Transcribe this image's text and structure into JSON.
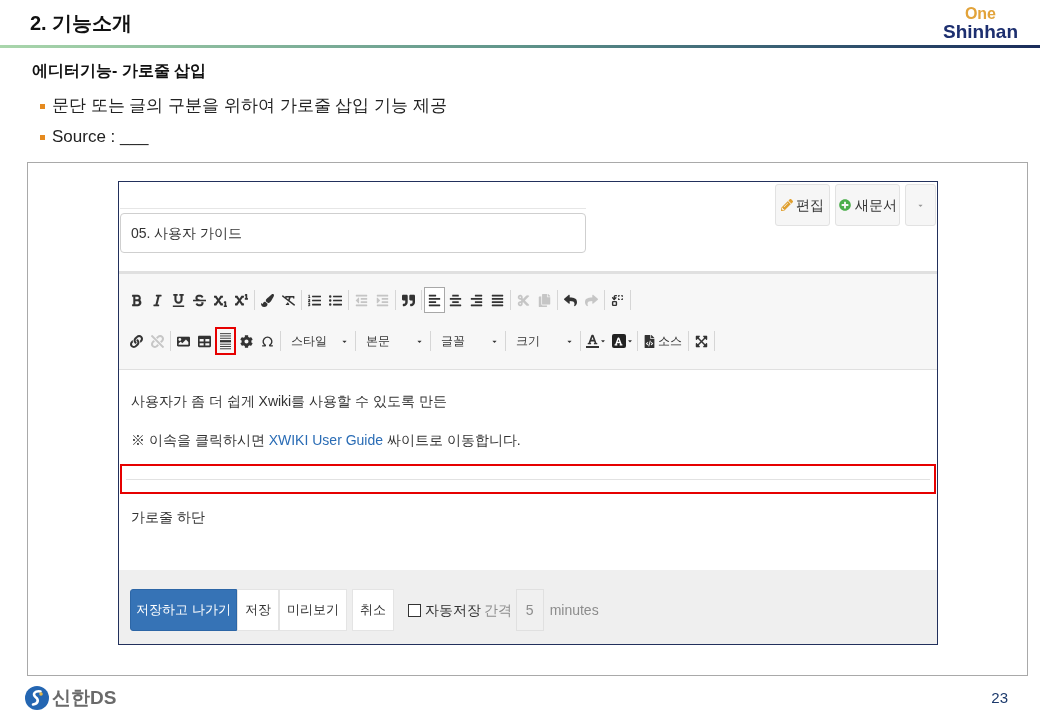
{
  "header": {
    "title": "2. 기능소개",
    "logo": {
      "top": "One",
      "bottom": "Shinhan"
    }
  },
  "heading": "에디터기능- 가로줄 삽입",
  "bullets": [
    "문단 또는 글의 구분을 위하여 가로줄 삽입 기능 제공",
    "Source : ___"
  ],
  "editor": {
    "page_actions": [
      {
        "kind": "edit",
        "label": "편집"
      },
      {
        "kind": "new",
        "label": "새문서"
      },
      {
        "kind": "more"
      }
    ],
    "title_field": {
      "value": "05. 사용자 가이드"
    },
    "toolbar_rows": [
      [
        [
          {
            "kind": "bold",
            "disabled": false,
            "active": false,
            "highlighted": false
          },
          {
            "kind": "italic",
            "disabled": false,
            "active": false,
            "highlighted": false
          },
          {
            "kind": "underline",
            "disabled": false,
            "active": false,
            "highlighted": false
          },
          {
            "kind": "strike",
            "disabled": false,
            "active": false,
            "highlighted": false
          },
          {
            "kind": "subscript",
            "disabled": false,
            "active": false,
            "highlighted": false
          },
          {
            "kind": "superscript",
            "disabled": false,
            "active": false,
            "highlighted": false
          }
        ],
        [
          {
            "kind": "paint",
            "disabled": false,
            "active": false,
            "highlighted": false
          },
          {
            "kind": "clearformat",
            "disabled": false,
            "active": false,
            "highlighted": false
          }
        ],
        [
          {
            "kind": "numbered",
            "disabled": false,
            "active": false,
            "highlighted": false
          },
          {
            "kind": "bulleted",
            "disabled": false,
            "active": false,
            "highlighted": false
          }
        ],
        [
          {
            "kind": "outdent",
            "disabled": true,
            "active": false,
            "highlighted": false
          },
          {
            "kind": "indent",
            "disabled": true,
            "active": false,
            "highlighted": false
          }
        ],
        [
          {
            "kind": "quote",
            "disabled": false,
            "active": false,
            "highlighted": false
          }
        ],
        [
          {
            "kind": "left",
            "disabled": false,
            "active": true,
            "highlighted": false
          },
          {
            "kind": "center",
            "disabled": false,
            "active": false,
            "highlighted": false
          },
          {
            "kind": "right",
            "disabled": false,
            "active": false,
            "highlighted": false
          },
          {
            "kind": "justify",
            "disabled": false,
            "active": false,
            "highlighted": false
          }
        ],
        [
          {
            "kind": "cut",
            "disabled": true,
            "active": false,
            "highlighted": false
          },
          {
            "kind": "copy",
            "disabled": true,
            "active": false,
            "highlighted": false
          }
        ],
        [
          {
            "kind": "undo",
            "disabled": false,
            "active": false,
            "highlighted": false
          },
          {
            "kind": "redo",
            "disabled": true,
            "active": false,
            "highlighted": false
          }
        ],
        [
          {
            "kind": "replace",
            "disabled": false,
            "active": false,
            "highlighted": false
          }
        ]
      ],
      [
        [
          {
            "kind": "link",
            "disabled": false,
            "active": false,
            "highlighted": false
          },
          {
            "kind": "unlink",
            "disabled": true,
            "active": false,
            "highlighted": false
          }
        ],
        [
          {
            "kind": "image",
            "disabled": false,
            "active": false,
            "highlighted": false
          },
          {
            "kind": "table",
            "disabled": false,
            "active": false,
            "highlighted": false
          },
          {
            "kind": "hr",
            "disabled": false,
            "active": false,
            "highlighted": true
          },
          {
            "kind": "gear",
            "disabled": false,
            "active": false,
            "highlighted": false
          },
          {
            "kind": "symbol",
            "disabled": false,
            "active": false,
            "highlighted": false
          }
        ],
        [
          {
            "kind": "combo",
            "label": "스타일",
            "disabled": false,
            "active": false,
            "highlighted": false
          }
        ],
        [
          {
            "kind": "combo",
            "label": "본문",
            "disabled": false,
            "active": false,
            "highlighted": false
          }
        ],
        [
          {
            "kind": "combo",
            "label": "글꼴",
            "disabled": false,
            "active": false,
            "highlighted": false
          }
        ],
        [
          {
            "kind": "combo",
            "label": "크기",
            "disabled": false,
            "active": false,
            "highlighted": false
          }
        ],
        [
          {
            "kind": "textcolor",
            "disabled": false,
            "active": false,
            "highlighted": false
          },
          {
            "kind": "bgcolor",
            "disabled": false,
            "active": false,
            "highlighted": false
          }
        ],
        [
          {
            "kind": "source",
            "label": "소스",
            "disabled": false,
            "active": false,
            "highlighted": false
          }
        ],
        [
          {
            "kind": "maximize",
            "disabled": false,
            "active": false,
            "highlighted": false
          }
        ]
      ]
    ],
    "content": [
      {
        "kind": "paragraph",
        "highlighted": false,
        "parts": [
          {
            "text": "사용자가 좀 더 쉽게 Xwiki를 사용할 수 있도록 만든",
            "link": false
          }
        ]
      },
      {
        "kind": "paragraph",
        "highlighted": false,
        "parts": [
          {
            "text": "※ 이속을 클릭하시면 ",
            "link": false
          },
          {
            "text": "XWIKI User Guide",
            "link": true
          },
          {
            "text": " 싸이트로 이동합니다.",
            "link": false
          }
        ]
      },
      {
        "kind": "rule",
        "highlighted": true
      },
      {
        "kind": "paragraph",
        "highlighted": false,
        "parts": [
          {
            "text": "가로줄 하단",
            "link": false
          }
        ]
      }
    ],
    "actions": [
      [
        {
          "label": "저장하고 나가기",
          "primary": true
        },
        {
          "label": "저장",
          "primary": false
        },
        {
          "label": "미리보기",
          "primary": false
        }
      ],
      [
        {
          "label": "취소",
          "primary": false
        }
      ]
    ],
    "autosave": {
      "label": "자동저장",
      "checked": false,
      "interval_label": "간격",
      "interval": "5",
      "unit": "minutes",
      "disabled": true
    }
  },
  "footer": {
    "logo": "신한DS",
    "page": "23"
  }
}
